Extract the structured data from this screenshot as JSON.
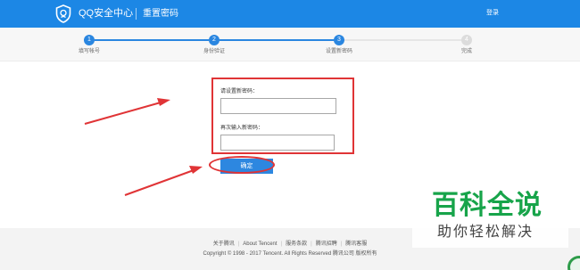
{
  "header": {
    "logo_text": "QQ安全中心",
    "subtitle": "重置密码",
    "login_label": "登录"
  },
  "progress": {
    "steps": [
      {
        "number": "1",
        "label": "填写帐号",
        "status": "done"
      },
      {
        "number": "2",
        "label": "身份验证",
        "status": "done"
      },
      {
        "number": "3",
        "label": "设置新密码",
        "status": "current"
      },
      {
        "number": "4",
        "label": "完成",
        "status": "todo"
      }
    ]
  },
  "form": {
    "new_password_label": "请设置新密码：",
    "new_password_value": "",
    "confirm_password_label": "再次输入新密码：",
    "confirm_password_value": "",
    "submit_label": "确定"
  },
  "footer": {
    "links": [
      "关于腾讯",
      "About Tencent",
      "服务条款",
      "腾讯招聘",
      "腾讯客服"
    ],
    "copyright": "Copyright © 1998 - 2017 Tencent. All Rights Reserved 腾讯公司 版权所有"
  },
  "watermark": {
    "title": "百科全说",
    "subtitle": "助你轻松解决"
  },
  "colors": {
    "header_blue": "#1c87e5",
    "step_blue": "#2a86e0",
    "annotation_red": "#e03436",
    "watermark_green": "#17a44a"
  },
  "icons": {
    "logo": "shield-icon",
    "annotation": "arrow-icon"
  }
}
